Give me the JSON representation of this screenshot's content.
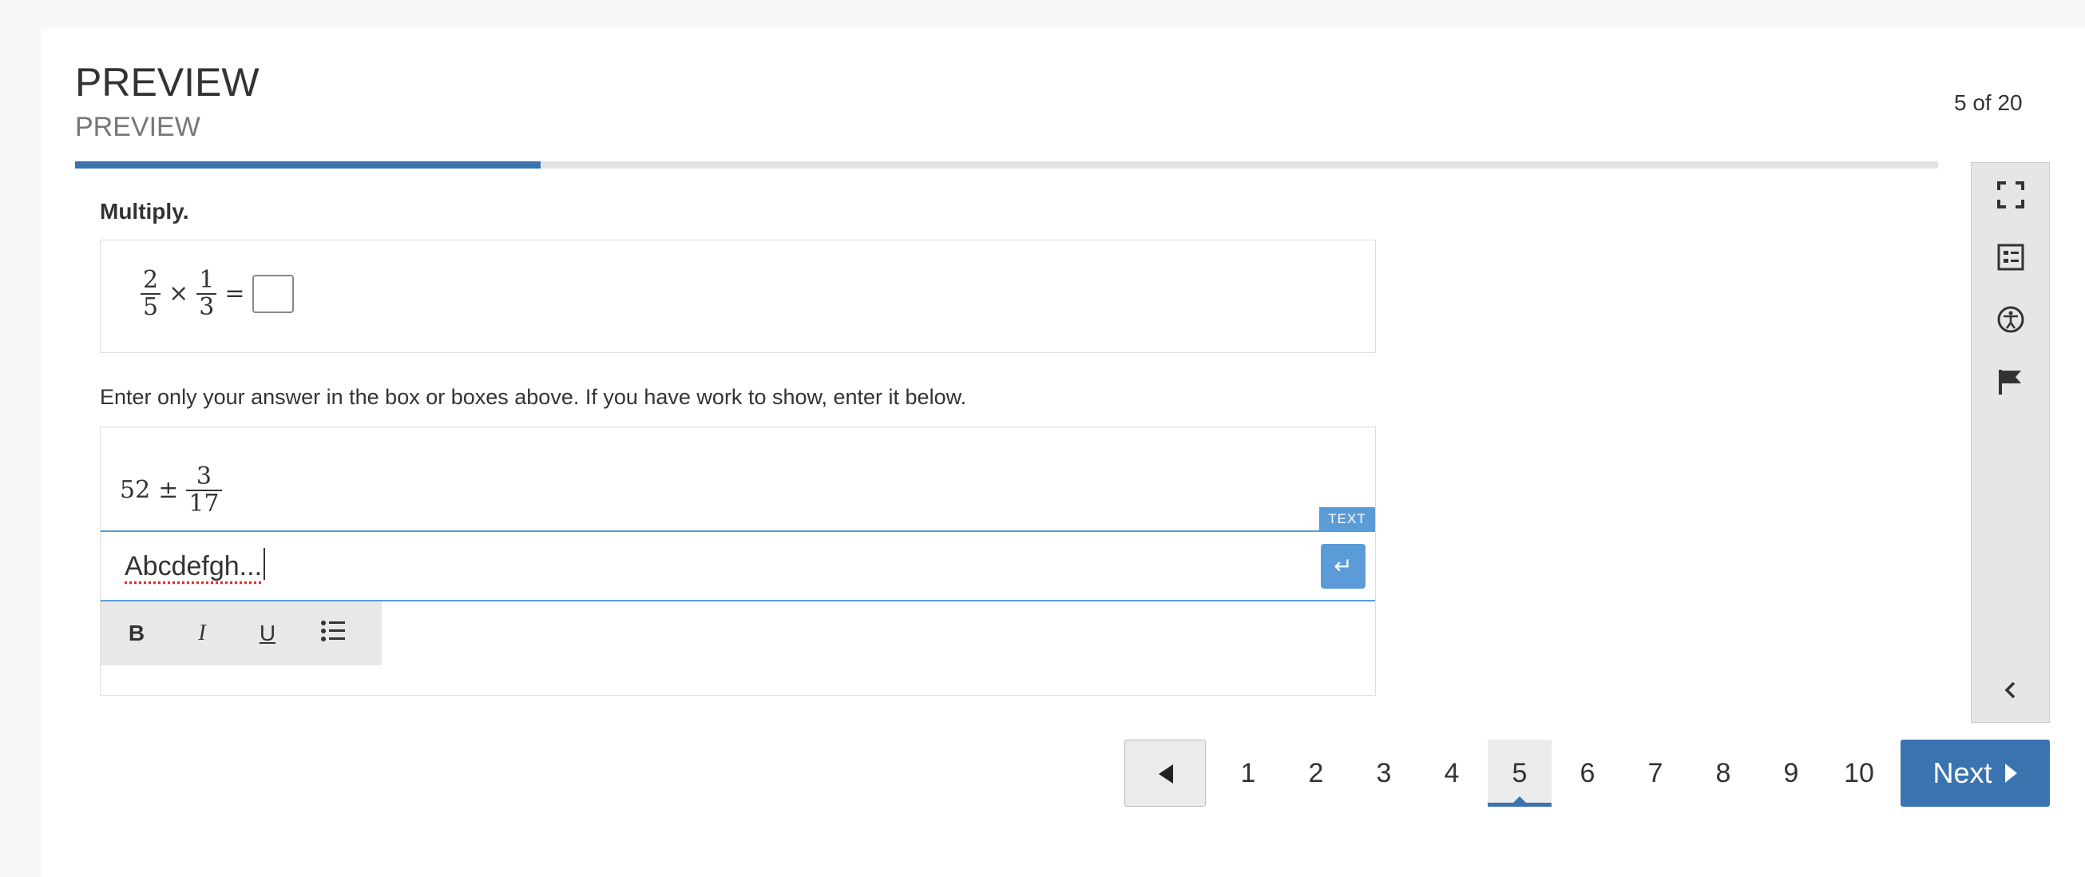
{
  "header": {
    "title": "PREVIEW",
    "subtitle": "PREVIEW",
    "counter": "5 of 20",
    "progress_fraction": 0.25
  },
  "question": {
    "prompt": "Multiply.",
    "expression": {
      "frac1_num": "2",
      "frac1_den": "5",
      "operator": "×",
      "frac2_num": "1",
      "frac2_den": "3",
      "equals": "="
    }
  },
  "instructions": "Enter only your answer in the box or boxes above.  If you have work to show, enter it below.",
  "work": {
    "whole": "52",
    "operator": "±",
    "frac_num": "3",
    "frac_den": "17",
    "text_tag": "TEXT",
    "text_value": "Abcdefgh...",
    "toolbar": {
      "bold": "B",
      "italic": "I",
      "underline": "U"
    }
  },
  "sidebar": {
    "icons": [
      "fullscreen-icon",
      "reference-sheet-icon",
      "accessibility-icon",
      "flag-icon",
      "collapse-chevron-icon"
    ]
  },
  "pagination": {
    "pages": [
      "1",
      "2",
      "3",
      "4",
      "5",
      "6",
      "7",
      "8",
      "9",
      "10"
    ],
    "current": "5",
    "next_label": "Next"
  },
  "colors": {
    "primary": "#3a73b0",
    "accent": "#5b9bd8"
  }
}
